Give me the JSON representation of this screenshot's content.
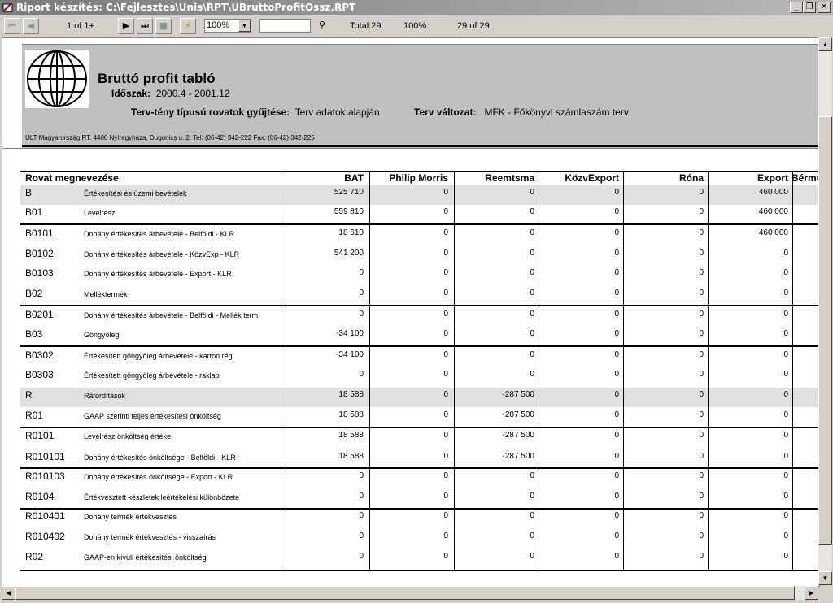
{
  "window": {
    "title": "Riport készítés: C:\\Fejlesztes\\Unis\\RPT\\UBruttoProfitOssz.RPT"
  },
  "toolbar": {
    "page_indicator": "1 of 1+",
    "zoom_value": "100%",
    "total_label": "Total:29",
    "percent_label": "100%",
    "record_label": "29 of 29"
  },
  "report": {
    "title": "Bruttó profit tabló",
    "period_label": "Időszak:",
    "period_value": "2000.4 - 2001.12",
    "collect_label": "Terv-tény típusú rovatok gyűjtése:",
    "collect_value": "Terv adatok alapján",
    "variant_label": "Terv változat:",
    "variant_value": "MFK - Főkönyvi számlaszám terv",
    "address": "ULT Magyarország RT. 4400 Nyíregyháza, Dugonics u. 2.  Tel: (06-42) 342-222  Fax: (06-42) 342-225"
  },
  "table": {
    "headers": [
      "Rovat megnevezése",
      "BAT",
      "Philip Morris",
      "Reemtsma",
      "KözvExport",
      "Róna",
      "Export",
      "Bérmu"
    ],
    "rows": [
      {
        "code": "B",
        "name": "Értékesítési és üzemi bevételek",
        "values": [
          "525 710",
          "0",
          "0",
          "0",
          "0",
          "460 000"
        ]
      },
      {
        "code": "B01",
        "name": "Levélrész",
        "values": [
          "559 810",
          "0",
          "0",
          "0",
          "0",
          "460 000"
        ]
      },
      {
        "code": "B0101",
        "name": "Dohány értékesítés árbevétele - Belföldi - KLR",
        "values": [
          "18 610",
          "0",
          "0",
          "0",
          "0",
          "460 000"
        ]
      },
      {
        "code": "B0102",
        "name": "Dohány értékesítés árbevétele - KözvExp - KLR",
        "values": [
          "541 200",
          "0",
          "0",
          "0",
          "0",
          "0"
        ]
      },
      {
        "code": "B0103",
        "name": "Dohány értékesítés árbevétele - Export - KLR",
        "values": [
          "0",
          "0",
          "0",
          "0",
          "0",
          "0"
        ]
      },
      {
        "code": "B02",
        "name": "Melléktermék",
        "values": [
          "0",
          "0",
          "0",
          "0",
          "0",
          "0"
        ]
      },
      {
        "code": "B0201",
        "name": "Dohány értékesítés árbevétele - Belföldi - Mellék term.",
        "values": [
          "0",
          "0",
          "0",
          "0",
          "0",
          "0"
        ]
      },
      {
        "code": "B03",
        "name": "Göngyöleg",
        "values": [
          "-34 100",
          "0",
          "0",
          "0",
          "0",
          "0"
        ]
      },
      {
        "code": "B0302",
        "name": "Értékesített göngyöleg árbevétele - karton régi",
        "values": [
          "-34 100",
          "0",
          "0",
          "0",
          "0",
          "0"
        ]
      },
      {
        "code": "B0303",
        "name": "Értékesített göngyöleg árbevétele - raklap",
        "values": [
          "0",
          "0",
          "0",
          "0",
          "0",
          "0"
        ]
      },
      {
        "code": "R",
        "name": "Ráfordítások",
        "values": [
          "18 588",
          "0",
          "-287 500",
          "0",
          "0",
          "0"
        ]
      },
      {
        "code": "R01",
        "name": "GAAP szerinti teljes értékesítési önköltség",
        "values": [
          "18 588",
          "0",
          "-287 500",
          "0",
          "0",
          "0"
        ]
      },
      {
        "code": "R0101",
        "name": "Levélrész önköltség értéke",
        "values": [
          "18 588",
          "0",
          "-287 500",
          "0",
          "0",
          "0"
        ]
      },
      {
        "code": "R010101",
        "name": "Dohány értékesítés önköltsége - Belföldi - KLR",
        "values": [
          "18 588",
          "0",
          "-287 500",
          "0",
          "0",
          "0"
        ]
      },
      {
        "code": "R010103",
        "name": "Dohány értékesítés önköltsége - Export - KLR",
        "values": [
          "0",
          "0",
          "0",
          "0",
          "0",
          "0"
        ]
      },
      {
        "code": "R0104",
        "name": "Értékvesztett készletek leértékelési különbözete",
        "values": [
          "0",
          "0",
          "0",
          "0",
          "0",
          "0"
        ]
      },
      {
        "code": "R010401",
        "name": "Dohány termék értékvesztés",
        "values": [
          "0",
          "0",
          "0",
          "0",
          "0",
          "0"
        ]
      },
      {
        "code": "R010402",
        "name": "Dohány termék értékvesztés - visszaírás",
        "values": [
          "0",
          "0",
          "0",
          "0",
          "0",
          "0"
        ]
      },
      {
        "code": "R02",
        "name": "GAAP-en kívüli értékesítési önköltség",
        "values": [
          "0",
          "0",
          "0",
          "0",
          "0",
          "0"
        ]
      }
    ]
  },
  "icons": {
    "first": "first-page-icon",
    "prev": "prev-page-icon",
    "next": "next-page-icon",
    "last": "last-page-icon",
    "stop": "stop-icon",
    "refresh": "lightning-icon",
    "search": "binoculars-icon"
  }
}
